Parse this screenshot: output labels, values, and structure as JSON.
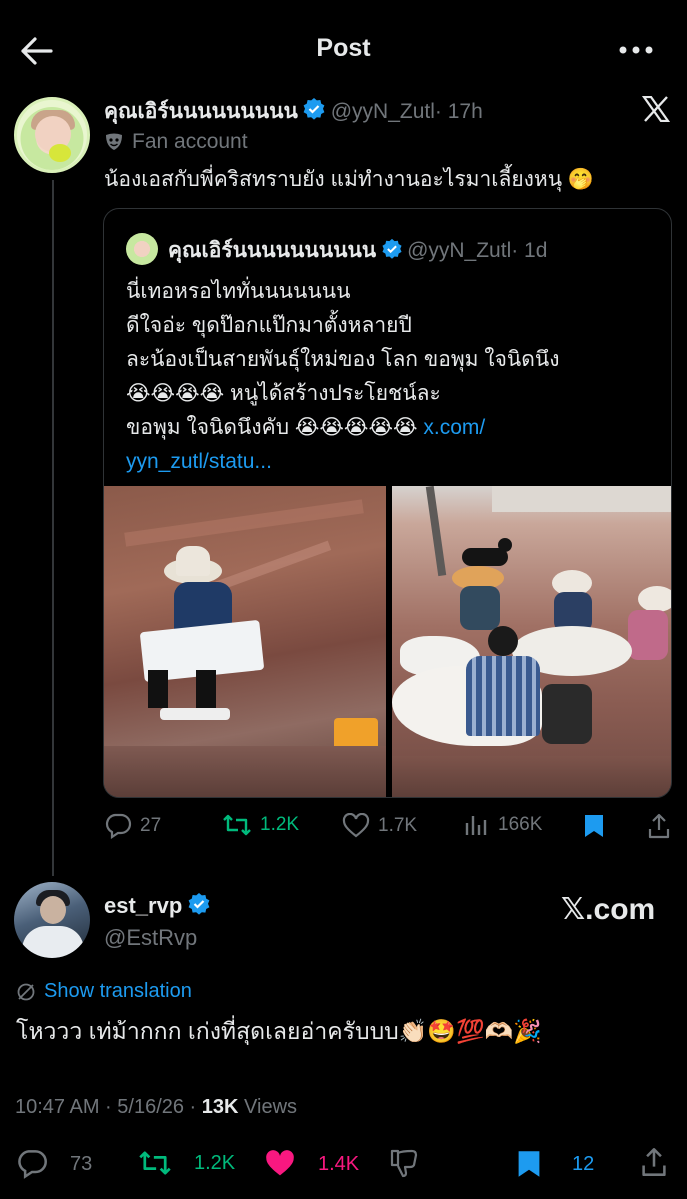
{
  "header": {
    "title": "Post"
  },
  "tweet": {
    "name": "คุณเอิร์นนนนนนนนน",
    "handle": "@yyN_Zutl",
    "time": "· 17h",
    "label": "Fan account",
    "text": "น้องเอสกับพี่คริสทราบยัง แม่ทำงานอะไรมาเลี้ยงหนุ 🤭",
    "quote": {
      "name": "คุณเอิร์นนนนนนนนนน",
      "handle": "@yyN_Zutl",
      "time": "· 1d",
      "line1": "นี่เทอหรอไททั่นนนนนนน",
      "line2": "ดีใจอ่ะ ขุดป๊อกแป๊กมาตั้งหลายปี",
      "line3": "ละน้องเป็นสายพันธุ์ใหม่ของ โลก ขอพุม ใจนิดนึง",
      "line4": "😭😭😭😭 หนูได้สร้างประโยชน์ละ",
      "line5_text": "ขอพุม ใจนิดนึงคับ 😭😭😭😭😭",
      "link1": " x.com/",
      "link2": "yyn_zutl/statu..."
    },
    "actions": {
      "replies": "27",
      "reposts": "1.2K",
      "likes": "1.7K",
      "views": "166K"
    }
  },
  "reply": {
    "name": "est_rvp",
    "handle": "@EstRvp",
    "source": "𝕏.com",
    "show_translation": "Show translation",
    "text": "โหววว เท่ม้ากกก เก่งที่สุดเลยอ่าครับบบ👏🏻🤩💯🫶🏻🎉",
    "meta_time": "10:47 AM · 5/16/26 · ",
    "meta_views_count": "13K",
    "meta_views_label": " Views",
    "actions": {
      "replies": "73",
      "reposts": "1.2K",
      "likes": "1.4K",
      "bookmarks": "12"
    }
  },
  "colors": {
    "accent": "#1d9bf0",
    "repost": "#00ba7c",
    "like": "#f91880",
    "muted": "#71767b"
  }
}
